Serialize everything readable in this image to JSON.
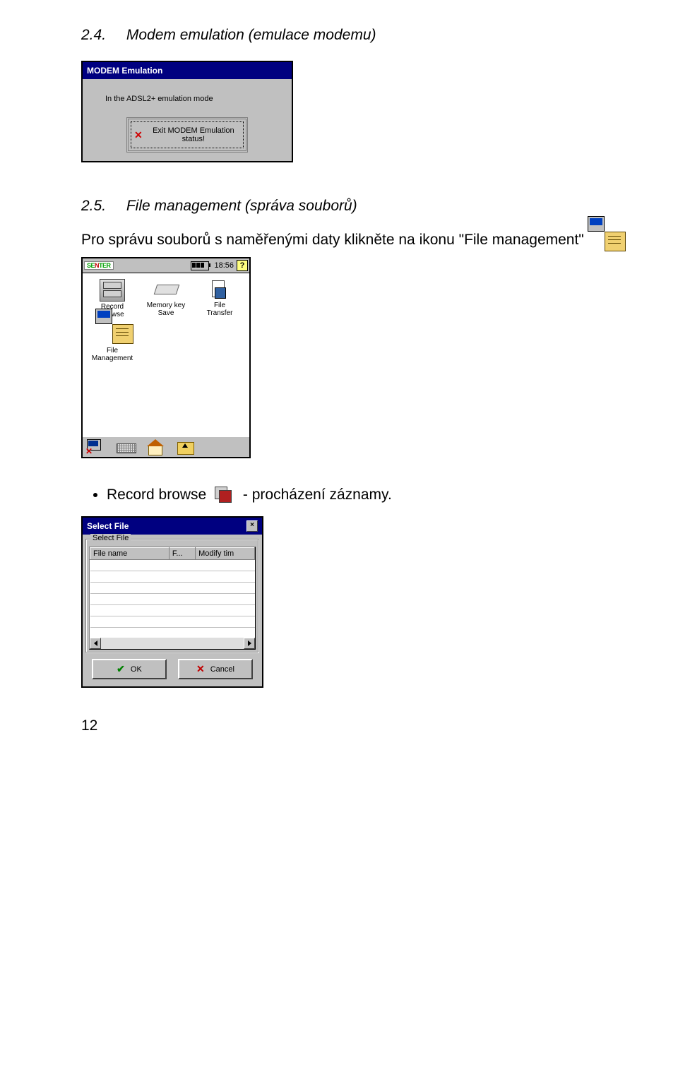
{
  "sections": {
    "s24": {
      "num": "2.4.",
      "title": "Modem emulation (emulace modemu)"
    },
    "s25": {
      "num": "2.5.",
      "title": "File management (správa souborů)"
    }
  },
  "modem_window": {
    "title": "MODEM Emulation",
    "message": "In the ADSL2+ emulation mode",
    "exit_button": "Exit MODEM Emulation status!"
  },
  "fm_sentence": {
    "before": "Pro správu souborů s naměřenými daty klikněte na ikonu \"File management\""
  },
  "senter": {
    "logo": "SENTER",
    "time": "18:56",
    "help": "?",
    "apps": [
      {
        "label1": "Record",
        "label2": "Browse"
      },
      {
        "label1": "Memory key",
        "label2": "Save"
      },
      {
        "label1": "File",
        "label2": "Transfer"
      },
      {
        "label1": "File",
        "label2": "Management"
      }
    ]
  },
  "record_browse": {
    "label": "Record browse",
    "desc": "- procházení záznamy."
  },
  "select_file": {
    "title": "Select File",
    "group": "Select File",
    "cols": [
      "File name",
      "F...",
      "Modify tim"
    ],
    "rows": 7,
    "ok": "OK",
    "cancel": "Cancel"
  },
  "page_number": "12"
}
